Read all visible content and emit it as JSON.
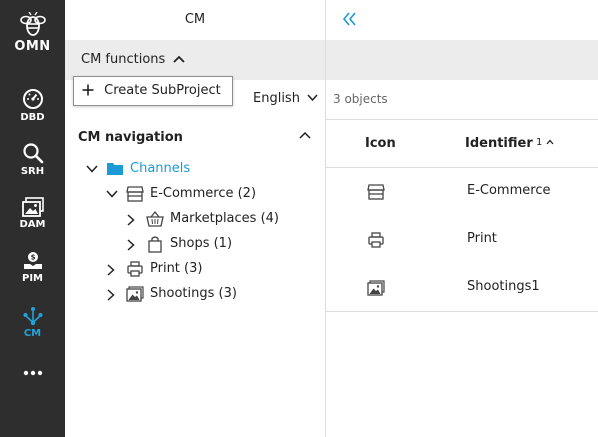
{
  "rail": {
    "logo_text": "OMN",
    "items": [
      {
        "label": "DBD",
        "icon": "dashboard-icon"
      },
      {
        "label": "SRH",
        "icon": "search-icon"
      },
      {
        "label": "DAM",
        "icon": "dam-image-icon"
      },
      {
        "label": "PIM",
        "icon": "pim-box-icon"
      },
      {
        "label": "CM",
        "icon": "cm-network-icon",
        "active": true
      },
      {
        "label": "",
        "icon": "more-icon"
      }
    ],
    "active_color": "#22a2dc",
    "background": "#2e2e2e"
  },
  "panel": {
    "title": "CM",
    "functions_label": "CM functions",
    "create_subproject_label": "Create SubProject",
    "language": "English",
    "nav_title": "CM navigation",
    "tree": [
      {
        "label": "Channels",
        "icon": "folder-icon",
        "expanded": true,
        "selected": true
      },
      {
        "label": "E-Commerce (2)",
        "icon": "store-icon",
        "expanded": true
      },
      {
        "label": "Marketplaces (4)",
        "icon": "basket-icon",
        "expanded": false
      },
      {
        "label": "Shops (1)",
        "icon": "shopping-bag-icon",
        "expanded": false
      },
      {
        "label": "Print (3)",
        "icon": "printer-icon",
        "expanded": false
      },
      {
        "label": "Shootings (3)",
        "icon": "photo-icon",
        "expanded": false
      }
    ]
  },
  "main": {
    "object_count": "3 objects",
    "columns": {
      "icon": "Icon",
      "identifier": "Identifier",
      "sort_indicator": "1^"
    },
    "rows": [
      {
        "icon": "store-icon",
        "identifier": "E-Commerce"
      },
      {
        "icon": "printer-icon",
        "identifier": "Print"
      },
      {
        "icon": "photo-icon",
        "identifier": "Shootings1"
      }
    ]
  },
  "colors": {
    "accent": "#1b9ad6",
    "toolbar_gray": "#ececec",
    "rail_bg": "#2e2e2e"
  }
}
